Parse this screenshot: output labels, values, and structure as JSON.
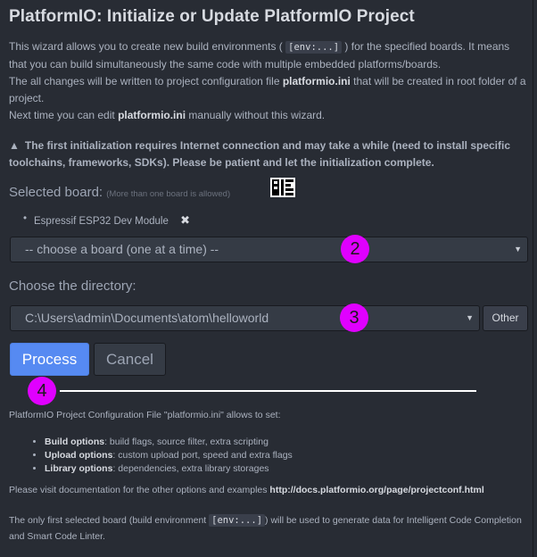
{
  "title": "PlatformIO: Initialize or Update PlatformIO Project",
  "description": {
    "line1_pre": "This wizard allows you to create new build environments (",
    "line1_code": "[env:...]",
    "line1_post": ") for the specified boards. It means that you can build simultaneously the same code with multiple embedded platforms/boards.",
    "line2_pre": "The all changes will be written to project configuration file ",
    "line2_file": "platformio.ini",
    "line2_post": " that will be created in root folder of a project.",
    "line3_pre": "Next time you can edit ",
    "line3_file": "platformio.ini",
    "line3_post": " manually without this wizard."
  },
  "warning": "The first initialization requires Internet connection and may take a while (need to install specific toolchains, frameworks, SDKs). Please be patient and let the initialization complete.",
  "selected_board": {
    "label": "Selected board:",
    "hint": "(More than one board is allowed)",
    "items": [
      "Espressif ESP32 Dev Module"
    ],
    "remove_glyph": "✖"
  },
  "board_select": {
    "value": "-- choose a board (one at a time) --",
    "arrow": "▼"
  },
  "directory": {
    "label": "Choose the directory:",
    "value": "C:\\Users\\admin\\Documents\\atom\\helloworld",
    "arrow": "▼",
    "other_label": "Other"
  },
  "buttons": {
    "process": "Process",
    "cancel": "Cancel"
  },
  "markers": [
    "2",
    "3",
    "4"
  ],
  "config_info": {
    "intro": "PlatformIO Project Configuration File \"platformio.ini\" allows to set:",
    "options": [
      {
        "name": "Build options",
        "desc": ": build flags, source filter, extra scripting"
      },
      {
        "name": "Upload options",
        "desc": ": custom upload port, speed and extra flags"
      },
      {
        "name": "Library options",
        "desc": ": dependencies, extra library storages"
      }
    ],
    "docs_pre": "Please visit documentation for the other options and examples ",
    "docs_link": "http://docs.platformio.org/page/projectconf.html",
    "footer_pre": "The only first selected board (build environment ",
    "footer_code": "[env:...]",
    "footer_post": ") will be used to generate data for Intelligent Code Completion and Smart Code Linter."
  },
  "colors": {
    "background": "#282c34",
    "primary_button": "#568af2",
    "marker": "#e000ff"
  }
}
